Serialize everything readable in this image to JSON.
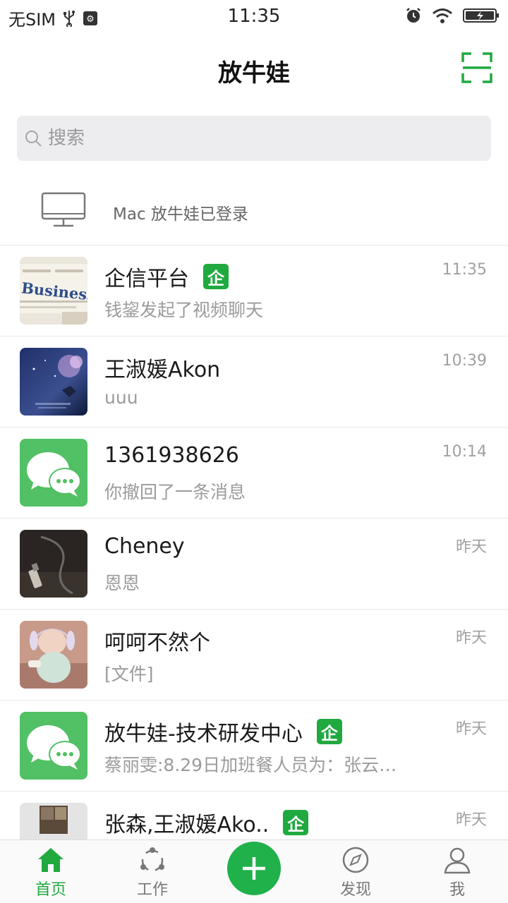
{
  "status_bar": {
    "carrier": "无SIM",
    "time": "11:35"
  },
  "header": {
    "title": "放牛娃"
  },
  "search": {
    "placeholder": "搜索"
  },
  "login_notice": {
    "text": "Mac 放牛娃已登录"
  },
  "chats": [
    {
      "name": "企信平台",
      "message": "钱鋆发起了视频聊天",
      "time": "11:35",
      "enterprise": true,
      "badge": "企"
    },
    {
      "name": "王淑媛Akon",
      "message": "uuu",
      "time": "10:39",
      "enterprise": false
    },
    {
      "name": "1361938626",
      "message": "你撤回了一条消息",
      "time": "10:14",
      "enterprise": false
    },
    {
      "name": "Cheney",
      "message": "恩恩",
      "time": "昨天",
      "enterprise": false
    },
    {
      "name": "呵呵不然个",
      "message": "[文件]",
      "time": "昨天",
      "enterprise": false
    },
    {
      "name": "放牛娃-技术研发中心",
      "message": "蔡丽雯:8.29日加班餐人员为：张云…",
      "time": "昨天",
      "enterprise": true,
      "badge": "企"
    },
    {
      "name": "张森,王淑媛Ako..",
      "message": "",
      "time": "昨天",
      "enterprise": true,
      "badge": "企"
    }
  ],
  "avatar_texts": {
    "business": "Business"
  },
  "tabs": [
    {
      "label": "首页",
      "active": true,
      "icon": "home-icon"
    },
    {
      "label": "工作",
      "active": false,
      "icon": "work-icon"
    },
    {
      "label": "发现",
      "active": false,
      "icon": "compass-icon"
    },
    {
      "label": "我",
      "active": false,
      "icon": "person-icon"
    }
  ],
  "colors": {
    "accent": "#20a93f",
    "wechat_green": "#52c064"
  }
}
